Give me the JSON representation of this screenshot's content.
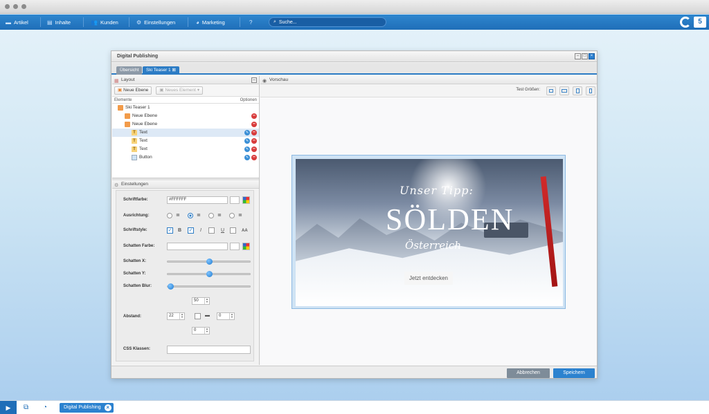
{
  "nav": {
    "items": [
      {
        "label": "Artikel",
        "icon": "article-icon"
      },
      {
        "label": "Inhalte",
        "icon": "content-icon"
      },
      {
        "label": "Kunden",
        "icon": "customers-icon"
      },
      {
        "label": "Einstellungen",
        "icon": "gear-icon"
      },
      {
        "label": "Marketing",
        "icon": "marketing-icon"
      }
    ],
    "search_placeholder": "Suche..."
  },
  "window": {
    "title": "Digital Publishing",
    "tabs": [
      {
        "label": "Übersicht"
      },
      {
        "label": "Ski Teaser 1"
      }
    ]
  },
  "layout_panel": {
    "title": "Layout",
    "toolbar": {
      "new_layer": "Neue Ebene",
      "new_element": "Neues Element"
    },
    "columns": {
      "elements": "Elemente",
      "options": "Optionen"
    },
    "tree": [
      {
        "label": "Ski Teaser 1",
        "level": 0,
        "type": "root"
      },
      {
        "label": "Neue Ebene",
        "level": 1,
        "type": "layer"
      },
      {
        "label": "Neue Ebene",
        "level": 1,
        "type": "layer"
      },
      {
        "label": "Text",
        "level": 2,
        "type": "text",
        "selected": true
      },
      {
        "label": "Text",
        "level": 2,
        "type": "text"
      },
      {
        "label": "Text",
        "level": 2,
        "type": "text"
      },
      {
        "label": "Button",
        "level": 2,
        "type": "button"
      }
    ]
  },
  "settings": {
    "title": "Einstellungen",
    "font_color_label": "Schriftfarbe:",
    "font_color_value": "#FFFFFF",
    "alignment_label": "Ausrichtung:",
    "alignment_selected": "center",
    "font_style_label": "Schriftstyle:",
    "font_style_glyphs": {
      "bold": "B",
      "italic": "I",
      "underline": "U",
      "caps": "AA"
    },
    "font_style_checked": {
      "first": true,
      "bold": true,
      "italic": false,
      "underline": false,
      "caps": false
    },
    "shadow_color_label": "Schatten Farbe:",
    "shadow_color_value": "",
    "shadow_x_label": "Schatten X:",
    "shadow_x_level": 0.5,
    "shadow_y_label": "Schatten Y:",
    "shadow_y_level": 0.5,
    "shadow_blur_label": "Schatten Blur:",
    "shadow_blur_level": 0.0,
    "spacing_label": "Abstand:",
    "spacing": {
      "top": "50",
      "left": "22",
      "right": "0",
      "bottom": "0"
    },
    "css_label": "CSS Klassen:",
    "css_value": ""
  },
  "preview": {
    "title": "Vorschau",
    "test_sizes_label": "Test Größen:",
    "banner": {
      "line1": "Unser Tipp:",
      "headline": "SÖLDEN",
      "line3": "Österreich",
      "cta": "Jetzt entdecken"
    }
  },
  "footer": {
    "cancel": "Abbrechen",
    "save": "Speichern"
  },
  "taskbar": {
    "task": "Digital Publishing"
  },
  "colors": {
    "accent": "#2c82cf",
    "appbar": "#1f6eb8",
    "delete": "#d83b3b"
  }
}
